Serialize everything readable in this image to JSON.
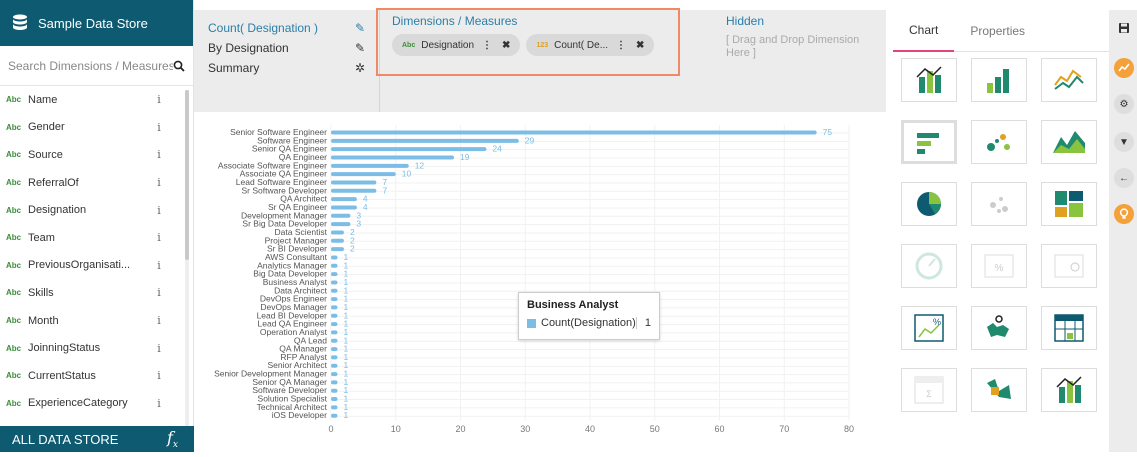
{
  "left_panel": {
    "title": "Sample Data Store",
    "search_placeholder": "Search Dimensions / Measures",
    "fields": [
      {
        "type": "Abc",
        "name": "Name"
      },
      {
        "type": "Abc",
        "name": "Gender"
      },
      {
        "type": "Abc",
        "name": "Source"
      },
      {
        "type": "Abc",
        "name": "ReferralOf"
      },
      {
        "type": "Abc",
        "name": "Designation"
      },
      {
        "type": "Abc",
        "name": "Team"
      },
      {
        "type": "Abc",
        "name": "PreviousOrganisati..."
      },
      {
        "type": "Abc",
        "name": "Skills"
      },
      {
        "type": "Abc",
        "name": "Month"
      },
      {
        "type": "Abc",
        "name": "JoinningStatus"
      },
      {
        "type": "Abc",
        "name": "CurrentStatus"
      },
      {
        "type": "Abc",
        "name": "ExperienceCategory"
      }
    ],
    "info_glyph": "i",
    "footer_label": "ALL DATA STORE",
    "footer_icon": "fx"
  },
  "config": {
    "measure_title": "Count( Designation )",
    "by_label": "By Designation",
    "summary_label": "Summary",
    "dims_title": "Dimensions / Measures",
    "pills": [
      {
        "type": "Abc",
        "label": "Designation"
      },
      {
        "type": "123",
        "label": "Count( De..."
      }
    ],
    "hidden_title": "Hidden",
    "hidden_hint": "[ Drag and Drop Dimension Here ]"
  },
  "chart_data": {
    "type": "bar",
    "orientation": "horizontal",
    "categories": [
      "Senior Software Engineer",
      "Software Engineer",
      "Senior QA Engineer",
      "QA Engineer",
      "Associate Software Engineer",
      "Associate QA Engineer",
      "Lead Software Engineer",
      "Sr Software Developer",
      "QA Architect",
      "Sr QA Engineer",
      "Development Manager",
      "Sr Big Data Developer",
      "Data Scientist",
      "Project Manager",
      "Sr BI Developer",
      "AWS Consultant",
      "Analytics Manager",
      "Big Data Developer",
      "Business Analyst",
      "Data Architect",
      "DevOps Engineer",
      "DevOps Manager",
      "Lead BI Developer",
      "Lead QA Engineer",
      "Operation Analyst",
      "QA Lead",
      "QA Manager",
      "RFP Analyst",
      "Senior Architect",
      "Senior Development Manager",
      "Senior QA Manager",
      "Software Developer",
      "Solution Specialist",
      "Technical Architect",
      "iOS Developer"
    ],
    "values": [
      75,
      29,
      24,
      19,
      12,
      10,
      7,
      7,
      4,
      4,
      3,
      3,
      2,
      2,
      2,
      1,
      1,
      1,
      1,
      1,
      1,
      1,
      1,
      1,
      1,
      1,
      1,
      1,
      1,
      1,
      1,
      1,
      1,
      1,
      1
    ],
    "xlim": [
      0,
      80
    ],
    "xticks": [
      "0",
      "10",
      "20",
      "30",
      "40",
      "50",
      "60",
      "70",
      "80"
    ],
    "grid": true,
    "bar_color": "#7cbde6"
  },
  "tooltip": {
    "title": "Business Analyst",
    "series": "Count(Designation)",
    "value": "1"
  },
  "right_panel": {
    "tabs": [
      "Chart",
      "Properties"
    ],
    "active_tab": "Chart",
    "chart_types": [
      "bar-line-icon",
      "column-icon",
      "line-icon",
      "bar-icon",
      "scatter-icon",
      "area-icon",
      "pie-icon",
      "bubble-icon",
      "treemap-icon",
      "gauge-icon",
      "kpi-icon",
      "progress-icon",
      "summary-card-icon",
      "map-icon",
      "table-icon",
      "cross-table-icon",
      "sankey-icon",
      "waterfall-icon"
    ]
  },
  "rail": {
    "icons": [
      "save-icon",
      "chart-line-icon",
      "settings-icon",
      "filter-icon",
      "back-arrow-icon",
      "bulb-icon"
    ]
  },
  "colors": {
    "accent": "#0e5a70",
    "highlight_border": "#ee8a68",
    "link_blue": "#2a7fa8",
    "orange": "#f4a13a",
    "active_tab": "#e4457a"
  }
}
